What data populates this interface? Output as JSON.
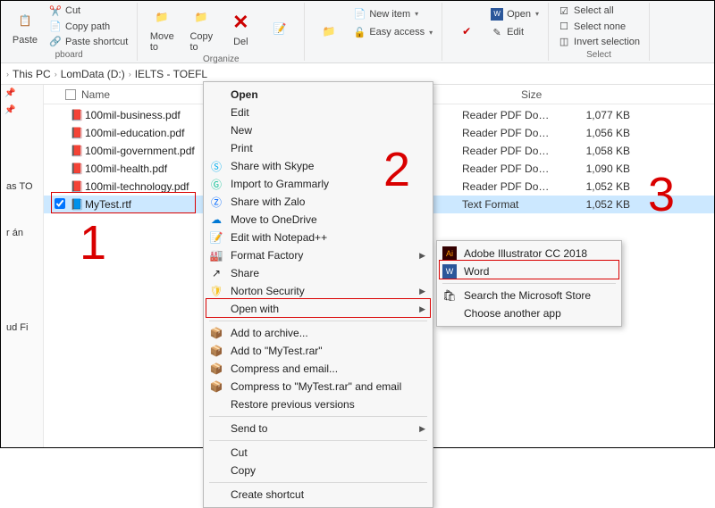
{
  "ribbon": {
    "clipboard": {
      "paste": "Paste",
      "cut": "Cut",
      "copy_path": "Copy path",
      "paste_shortcut": "Paste shortcut",
      "label": "pboard"
    },
    "organize": {
      "move": "Move\nto",
      "copy": "Copy\nto",
      "delete": "Del",
      "label": "Organize"
    },
    "new": {
      "new_item": "New item",
      "easy_access": "Easy access",
      "label": ""
    },
    "open": {
      "open": "Open",
      "edit": "Edit",
      "label": ""
    },
    "select": {
      "all": "Select all",
      "none": "Select none",
      "invert": "Invert selection",
      "label": "Select"
    }
  },
  "breadcrumb": {
    "pc": "This PC",
    "drive": "LomData (D:)",
    "folder": "IELTS - TOEFL"
  },
  "columns": {
    "name": "Name",
    "size": "Size"
  },
  "files": [
    {
      "name": "100mil-business.pdf",
      "type": "Reader PDF Do…",
      "size": "1,077 KB",
      "selected": false
    },
    {
      "name": "100mil-education.pdf",
      "type": "Reader PDF Do…",
      "size": "1,056 KB",
      "selected": false
    },
    {
      "name": "100mil-government.pdf",
      "type": "Reader PDF Do…",
      "size": "1,058 KB",
      "selected": false
    },
    {
      "name": "100mil-health.pdf",
      "type": "Reader PDF Do…",
      "size": "1,090 KB",
      "selected": false
    },
    {
      "name": "100mil-technology.pdf",
      "type": "Reader PDF Do…",
      "size": "1,052 KB",
      "selected": false
    },
    {
      "name": "MyTest.rtf",
      "type": "Text Format",
      "size": "1,052 KB",
      "selected": true
    }
  ],
  "sidebar": {
    "items": [
      "as TO",
      "r án",
      "ud Fi"
    ]
  },
  "context_menu": {
    "open": "Open",
    "edit": "Edit",
    "new": "New",
    "print": "Print",
    "skype": "Share with Skype",
    "grammarly": "Import to Grammarly",
    "zalo": "Share with Zalo",
    "onedrive": "Move to OneDrive",
    "notepad": "Edit with Notepad++",
    "format_factory": "Format Factory",
    "share": "Share",
    "norton": "Norton Security",
    "open_with": "Open with",
    "archive_add": "Add to archive...",
    "archive_mytest": "Add to \"MyTest.rar\"",
    "compress_email": "Compress and email...",
    "compress_mytest_email": "Compress to \"MyTest.rar\" and email",
    "restore": "Restore previous versions",
    "send_to": "Send to",
    "cut": "Cut",
    "copy": "Copy",
    "create_shortcut": "Create shortcut"
  },
  "open_with_menu": {
    "ai": "Adobe Illustrator CC 2018",
    "word": "Word",
    "store": "Search the Microsoft Store",
    "another": "Choose another app"
  },
  "annotations": {
    "one": "1",
    "two": "2",
    "three": "3"
  }
}
